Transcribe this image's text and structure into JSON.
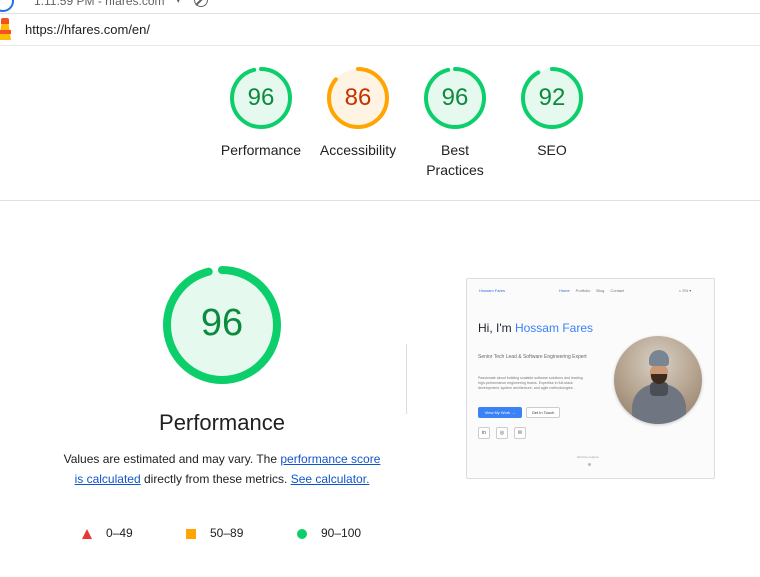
{
  "topbar": {
    "meta": "1:11:59 PM - hfares.com",
    "caret": "▾"
  },
  "url": "https://hfares.com/en/",
  "categories": [
    {
      "name": "Performance",
      "score": "96",
      "level": "pass",
      "fraction": 0.96
    },
    {
      "name": "Accessibility",
      "score": "86",
      "level": "average",
      "fraction": 0.86
    },
    {
      "name": "Best Practices",
      "score": "96",
      "level": "pass",
      "fraction": 0.96
    },
    {
      "name": "SEO",
      "score": "92",
      "level": "pass",
      "fraction": 0.92
    }
  ],
  "colors": {
    "pass": "#0cce6b",
    "pass_text": "#0c8a3e",
    "pass_fill": "#e6f9ef",
    "average": "#ffa400",
    "average_text": "#c33300",
    "average_fill": "#fff4e3",
    "fail": "#e53935",
    "link": "#1155cc"
  },
  "main": {
    "score": "96",
    "fraction": 0.96,
    "title": "Performance",
    "desc_prefix": "Values are estimated and may vary. The ",
    "desc_link1": "performance score is calculated",
    "desc_middle": " directly from these metrics. ",
    "desc_link2": "See calculator."
  },
  "legend": [
    {
      "range": "0–49",
      "shape": "triangle",
      "color": "#e53935"
    },
    {
      "range": "50–89",
      "shape": "square",
      "color": "#ffa400"
    },
    {
      "range": "90–100",
      "shape": "circle",
      "color": "#0cce6b"
    }
  ],
  "preview": {
    "brand": "Hossam Fares",
    "nav": [
      "Home",
      "Portfolio",
      "Blog",
      "Contact"
    ],
    "lang": "◐ EN ▾",
    "greeting": "Hi, I'm ",
    "name": "Hossam Fares",
    "subtitle": "Senior Tech Lead & Software Engineering Expert",
    "paragraph": "Passionate about building scalable software solutions and leading high-performance engineering teams. Expertise in full-stack development, system architecture, and agile methodologies.",
    "btn_primary": "View My Work →",
    "btn_secondary": "Get In Touch",
    "socials": [
      "in",
      "◎",
      "✉"
    ],
    "scroll": "Scroll to explore"
  }
}
